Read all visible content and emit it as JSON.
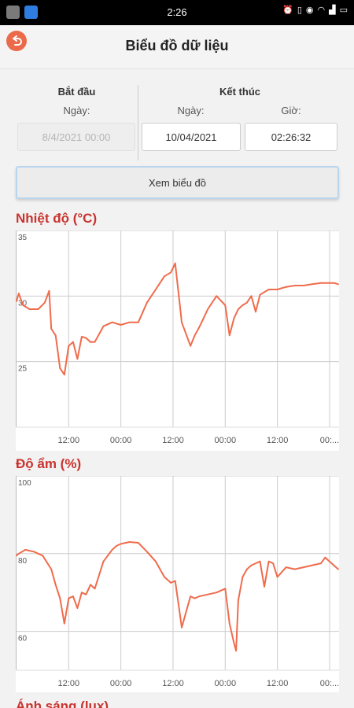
{
  "status_bar": {
    "time": "2:26",
    "icons": [
      "gallery-icon",
      "vpn-icon",
      "alarm-icon",
      "vibrate-icon",
      "battery-saver-icon",
      "wifi-icon",
      "signal-icon",
      "battery-icon"
    ]
  },
  "header": {
    "title": "Biểu đồ dữ liệu",
    "back_icon": "back-arrow-icon"
  },
  "form": {
    "start": {
      "label": "Bắt đầu",
      "date_label": "Ngày:",
      "date_value": "8/4/2021 00:00"
    },
    "end": {
      "label": "Kết thúc",
      "date_label": "Ngày:",
      "date_value": "10/04/2021",
      "time_label": "Giờ:",
      "time_value": "02:26:32"
    },
    "view_button": "Xem biểu đồ"
  },
  "charts": {
    "temperature": {
      "title": "Nhiệt độ (°C)"
    },
    "humidity": {
      "title": "Độ ẩm (%)"
    },
    "light": {
      "title": "Ánh sáng (lux)"
    }
  },
  "colors": {
    "series": "#ef6c4c",
    "title": "#c9332e",
    "grid": "#cccccc"
  },
  "chart_data": [
    {
      "type": "line",
      "title": "Nhiệt độ (°C)",
      "xlabel": "",
      "ylabel": "",
      "ylim": [
        20,
        35
      ],
      "yticks": [
        "25",
        "30",
        "35"
      ],
      "xticks": [
        "12:00",
        "00:00",
        "12:00",
        "00:00",
        "12:00",
        "00:..."
      ],
      "xtick_values": [
        12,
        24,
        36,
        48,
        60,
        72
      ],
      "xlim": [
        0,
        74
      ],
      "grid": true,
      "series": [
        {
          "x": [
            0,
            0.5,
            1.5,
            3,
            5,
            6.5,
            7.5,
            8,
            9,
            10,
            11,
            12,
            13,
            14,
            15,
            16,
            17,
            18,
            20,
            22,
            24,
            26,
            28,
            30,
            32,
            34,
            35.5,
            36.5,
            37,
            37.5,
            38,
            40,
            41,
            42,
            43,
            44,
            46,
            48,
            49,
            50,
            51,
            52,
            53,
            54,
            55,
            56,
            57,
            58,
            60,
            62,
            64,
            66,
            68,
            70,
            72,
            73,
            74
          ],
          "values": [
            29.6,
            30.2,
            29.3,
            29.0,
            29.0,
            29.5,
            30.4,
            27.5,
            27.0,
            24.5,
            24.0,
            26.2,
            26.5,
            25.2,
            26.9,
            26.8,
            26.5,
            26.5,
            27.7,
            28.0,
            27.8,
            28.0,
            28.0,
            29.5,
            30.5,
            31.5,
            31.8,
            32.5,
            31.0,
            29.5,
            28.0,
            26.2,
            27.0,
            27.6,
            28.3,
            29.0,
            30.0,
            29.3,
            27.0,
            28.3,
            29.0,
            29.3,
            29.5,
            30.0,
            28.8,
            30.1,
            30.3,
            30.5,
            30.5,
            30.7,
            30.8,
            30.8,
            30.9,
            31.0,
            31.0,
            31.0,
            30.9
          ]
        }
      ]
    },
    {
      "type": "line",
      "title": "Độ ẩm (%)",
      "xlabel": "",
      "ylabel": "",
      "ylim": [
        50,
        100
      ],
      "yticks": [
        "60",
        "80",
        "100"
      ],
      "xticks": [
        "12:00",
        "00:00",
        "12:00",
        "00:00",
        "12:00",
        "00:..."
      ],
      "xtick_values": [
        12,
        24,
        36,
        48,
        60,
        72
      ],
      "xlim": [
        0,
        74
      ],
      "grid": true,
      "series": [
        {
          "x": [
            0,
            0.5,
            2,
            4,
            6,
            8,
            9,
            10,
            11,
            12,
            13,
            14,
            15,
            16,
            17,
            18,
            20,
            22,
            23,
            24,
            26,
            28,
            30,
            32,
            34,
            35.5,
            36.5,
            37,
            37.5,
            38,
            40,
            41,
            42,
            44,
            46,
            48,
            49,
            50,
            50.5,
            51,
            52,
            53,
            54,
            55,
            56,
            57,
            58,
            59,
            60,
            62,
            64,
            66,
            68,
            70,
            71,
            72,
            74
          ],
          "values": [
            79.5,
            80.0,
            81.0,
            80.5,
            79.5,
            76.0,
            72.0,
            68.5,
            62.0,
            68.5,
            69.0,
            66.0,
            70.0,
            69.5,
            72.0,
            71.0,
            78.0,
            81.0,
            82.0,
            82.5,
            83.0,
            82.8,
            80.5,
            78.0,
            74.0,
            72.5,
            73.0,
            69.0,
            65.0,
            61.0,
            69.0,
            68.5,
            69.0,
            69.5,
            70.0,
            71.0,
            62.0,
            57.0,
            55.0,
            68.0,
            74.0,
            76.0,
            77.0,
            77.5,
            78.0,
            71.5,
            78.0,
            77.5,
            74.0,
            76.5,
            76.0,
            76.5,
            77.0,
            77.5,
            79.0,
            78.0,
            76.0
          ]
        }
      ]
    }
  ]
}
